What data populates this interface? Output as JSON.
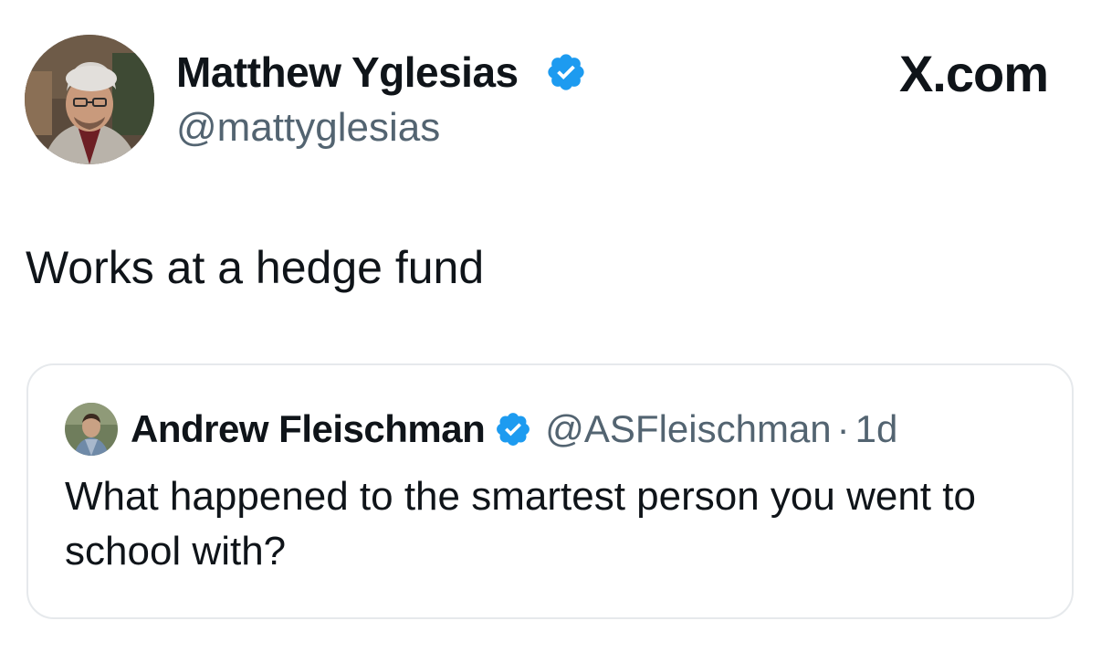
{
  "tweet": {
    "author_name": "Matthew Yglesias",
    "author_handle": "@mattyglesias",
    "site_label": "X.com",
    "text": "Works at a hedge fund"
  },
  "quoted_tweet": {
    "author_name": "Andrew Fleischman",
    "author_handle": "@ASFleischman",
    "separator": "·",
    "time": "1d",
    "text": "What happened to the smartest person you went to school with?"
  },
  "icons": {
    "verified": "verified-badge-icon",
    "avatar_main": "avatar",
    "avatar_quote": "avatar"
  },
  "colors": {
    "verified_blue": "#1d9bf0",
    "secondary_text": "#536471",
    "primary_text": "#0f1419",
    "card_border": "#e6e9ec"
  }
}
